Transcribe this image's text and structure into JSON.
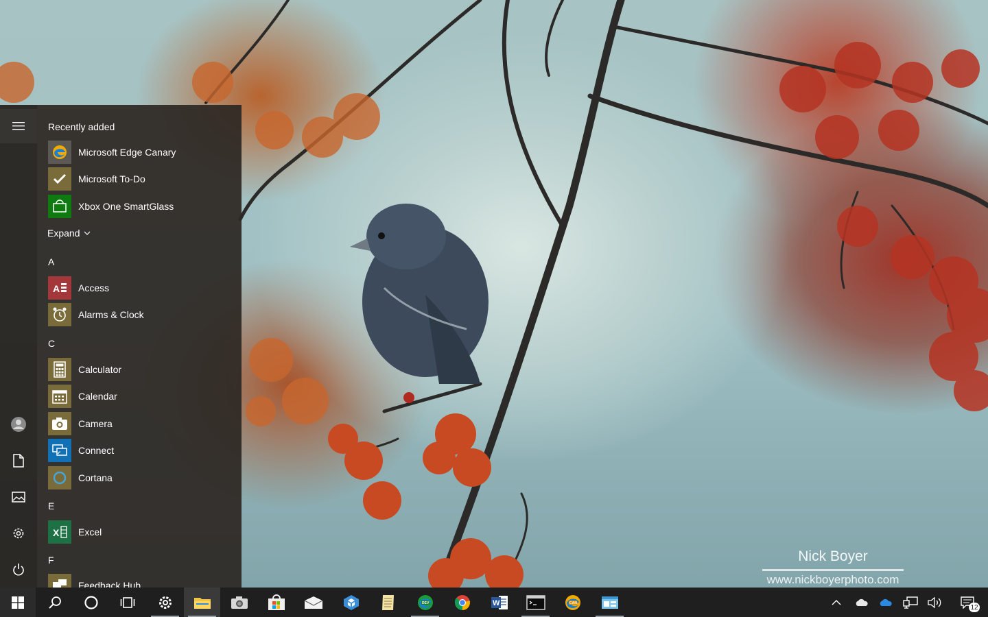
{
  "wallpaper": {
    "watermark_name": "Nick Boyer",
    "watermark_url": "www.nickboyerphoto.com"
  },
  "start_menu": {
    "recently_added_heading": "Recently added",
    "expand_label": "Expand",
    "recent_apps": [
      {
        "label": "Microsoft Edge Canary",
        "icon": "edge-canary-icon"
      },
      {
        "label": "Microsoft To-Do",
        "icon": "checkmark-icon"
      },
      {
        "label": "Xbox One SmartGlass",
        "icon": "xbox-smartglass-icon"
      }
    ],
    "groups": [
      {
        "letter": "A",
        "apps": [
          {
            "label": "Access",
            "icon": "access-icon"
          },
          {
            "label": "Alarms & Clock",
            "icon": "alarm-clock-icon"
          }
        ]
      },
      {
        "letter": "C",
        "apps": [
          {
            "label": "Calculator",
            "icon": "calculator-icon"
          },
          {
            "label": "Calendar",
            "icon": "calendar-icon"
          },
          {
            "label": "Camera",
            "icon": "camera-icon"
          },
          {
            "label": "Connect",
            "icon": "connect-icon"
          },
          {
            "label": "Cortana",
            "icon": "cortana-icon"
          }
        ]
      },
      {
        "letter": "E",
        "apps": [
          {
            "label": "Excel",
            "icon": "excel-icon"
          }
        ]
      },
      {
        "letter": "F",
        "apps": [
          {
            "label": "Feedback Hub",
            "icon": "feedback-hub-icon"
          }
        ]
      }
    ],
    "rail_icons": [
      "hamburger-menu-icon",
      "user-avatar-icon",
      "documents-icon",
      "pictures-icon",
      "settings-icon",
      "power-icon"
    ]
  },
  "taskbar": {
    "notification_count": "12",
    "pinned_icons": [
      "windows-start-icon",
      "search-icon",
      "cortana-icon",
      "task-view-icon",
      "settings-icon",
      "file-explorer-icon",
      "camera-icon",
      "store-icon",
      "mail-icon",
      "teams-icon",
      "notepad-icon",
      "edge-dev-icon",
      "chrome-icon",
      "word-icon",
      "terminal-icon",
      "edge-canary-icon",
      "control-panel-icon"
    ],
    "tray_icons": [
      "show-hidden-icons-chevron-icon",
      "onedrive-personal-icon",
      "onedrive-business-icon",
      "network-icon",
      "volume-icon",
      "action-center-icon"
    ],
    "colors": {
      "taskbar_bg": "#1f1f1f",
      "start_menu_bg": "#2d2824"
    }
  }
}
